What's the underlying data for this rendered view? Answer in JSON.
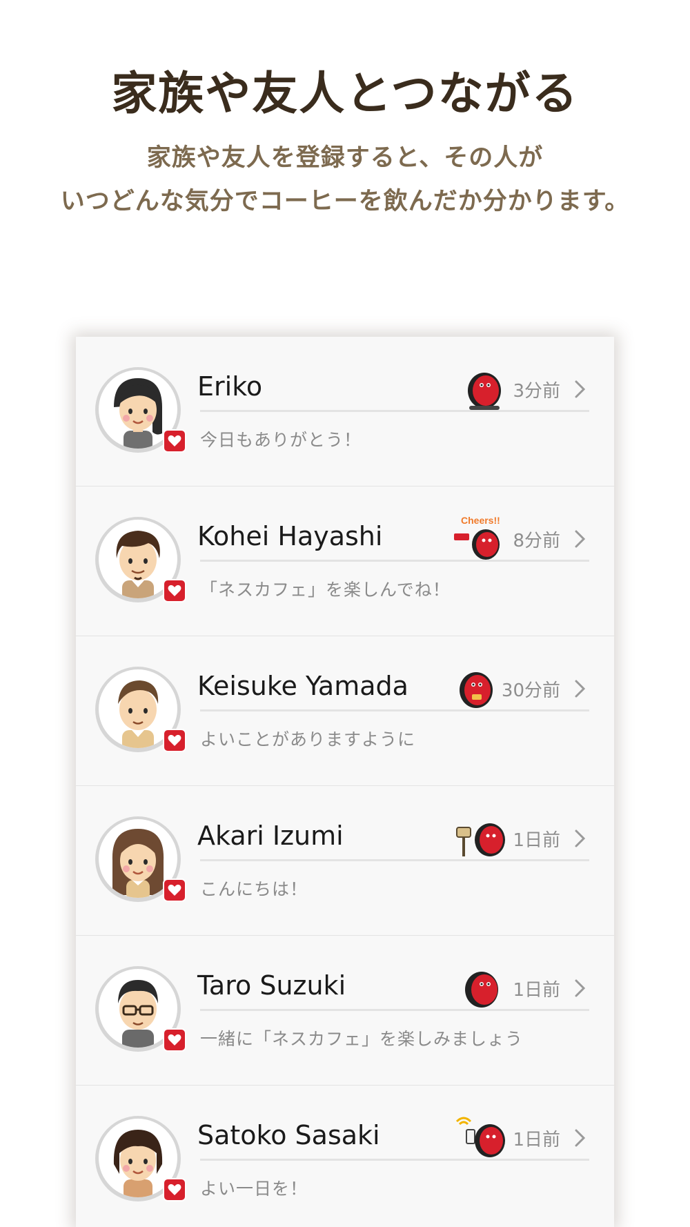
{
  "header": {
    "title": "家族や友人とつながる",
    "subtitle_line1": "家族や友人を登録すると、その人が",
    "subtitle_line2": "いつどんな気分でコーヒーを飲んだか分かります。"
  },
  "colors": {
    "title": "#3a2c1d",
    "subtitle": "#7d6a4f",
    "badge": "#d7202c",
    "sticker_red": "#d7202c"
  },
  "contacts": [
    {
      "name": "Eriko",
      "time": "3分前",
      "message": "今日もありがとう！",
      "avatar_icon": "woman-avatar-icon",
      "sticker_icon": "barista-character-icon"
    },
    {
      "name": "Kohei Hayashi",
      "time": "8分前",
      "message": "「ネスカフェ」を楽しんでね！",
      "avatar_icon": "man-beard-avatar-icon",
      "sticker_icon": "cheers-sticker-icon",
      "sticker_text": "Cheers!!"
    },
    {
      "name": "Keisuke Yamada",
      "time": "30分前",
      "message": "よいことがありますように",
      "avatar_icon": "man-avatar-icon",
      "sticker_icon": "barista-character-icon"
    },
    {
      "name": "Akari Izumi",
      "time": "1日前",
      "message": "こんにちは！",
      "avatar_icon": "woman-long-hair-avatar-icon",
      "sticker_icon": "mailbox-sticker-icon"
    },
    {
      "name": "Taro Suzuki",
      "time": "1日前",
      "message": "一緒に「ネスカフェ」を楽しみましょう",
      "avatar_icon": "man-glasses-avatar-icon",
      "sticker_icon": "barista-character-icon"
    },
    {
      "name": "Satoko Sasaki",
      "time": "1日前",
      "message": "よい一日を！",
      "avatar_icon": "woman-bob-avatar-icon",
      "sticker_icon": "phone-sticker-icon"
    }
  ]
}
